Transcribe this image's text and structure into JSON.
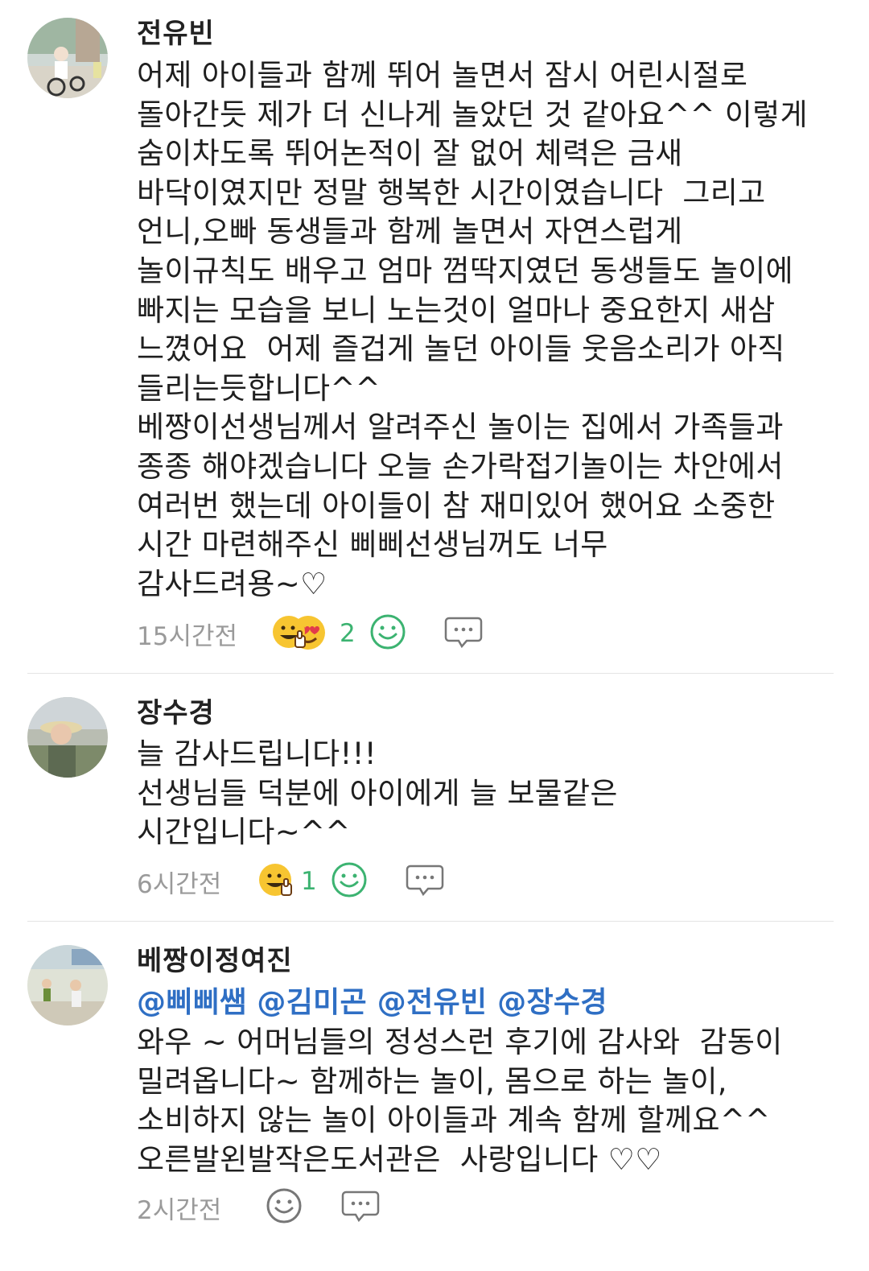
{
  "comments": [
    {
      "author": "전유빈",
      "mentions": "",
      "text": "어제 아이들과 함께 뛰어 놀면서 잠시 어린시절로\n돌아간듯 제가 더 신나게 놀았던 것 같아요^^ 이렇게\n숨이차도록 뛰어논적이 잘 없어 체력은 금새\n바닥이였지만 정말 행복한 시간이였습니다  그리고\n언니,오빠 동생들과 함께 놀면서 자연스럽게\n놀이규칙도 배우고 엄마 껌딱지였던 동생들도 놀이에\n빠지는 모습을 보니 노는것이 얼마나 중요한지 새삼\n느꼈어요  어제 즐겁게 놀던 아이들 웃음소리가 아직\n들리는듯합니다^^\n베짱이선생님께서 알려주신 놀이는 집에서 가족들과\n종종 해야겠습니다 오늘 손가락접기놀이는 차안에서\n여러번 했는데 아이들이 참 재미있어 했어요 소중한\n시간 마련해주신 삐삐선생님꺼도 너무\n감사드려용~♡",
      "time": "15시간전",
      "reaction_count": "2",
      "reactions": [
        "thumbs-up-smile-emoji",
        "heart-eyes-emoji"
      ]
    },
    {
      "author": "장수경",
      "mentions": "",
      "text": "늘 감사드립니다!!!\n선생님들 덕분에 아이에게 늘 보물같은\n시간입니다~^^",
      "time": "6시간전",
      "reaction_count": "1",
      "reactions": [
        "thumbs-up-smile-emoji"
      ]
    },
    {
      "author": "베짱이정여진",
      "mentions": "@삐삐쌤 @김미곤 @전유빈 @장수경",
      "text": "와우 ~ 어머님들의 정성스런 후기에 감사와  감동이\n밀려옵니다~ 함께하는 놀이, 몸으로 하는 놀이,\n소비하지 않는 놀이 아이들과 계속 함께 할께요^^\n오른발왼발작은도서관은  사랑입니다 ♡♡",
      "time": "2시간전",
      "reaction_count": "",
      "reactions": []
    }
  ],
  "colors": {
    "mention": "#2f6fc4",
    "count": "#3cb371",
    "time": "#9a9a9a",
    "icon": "#3cb371"
  }
}
